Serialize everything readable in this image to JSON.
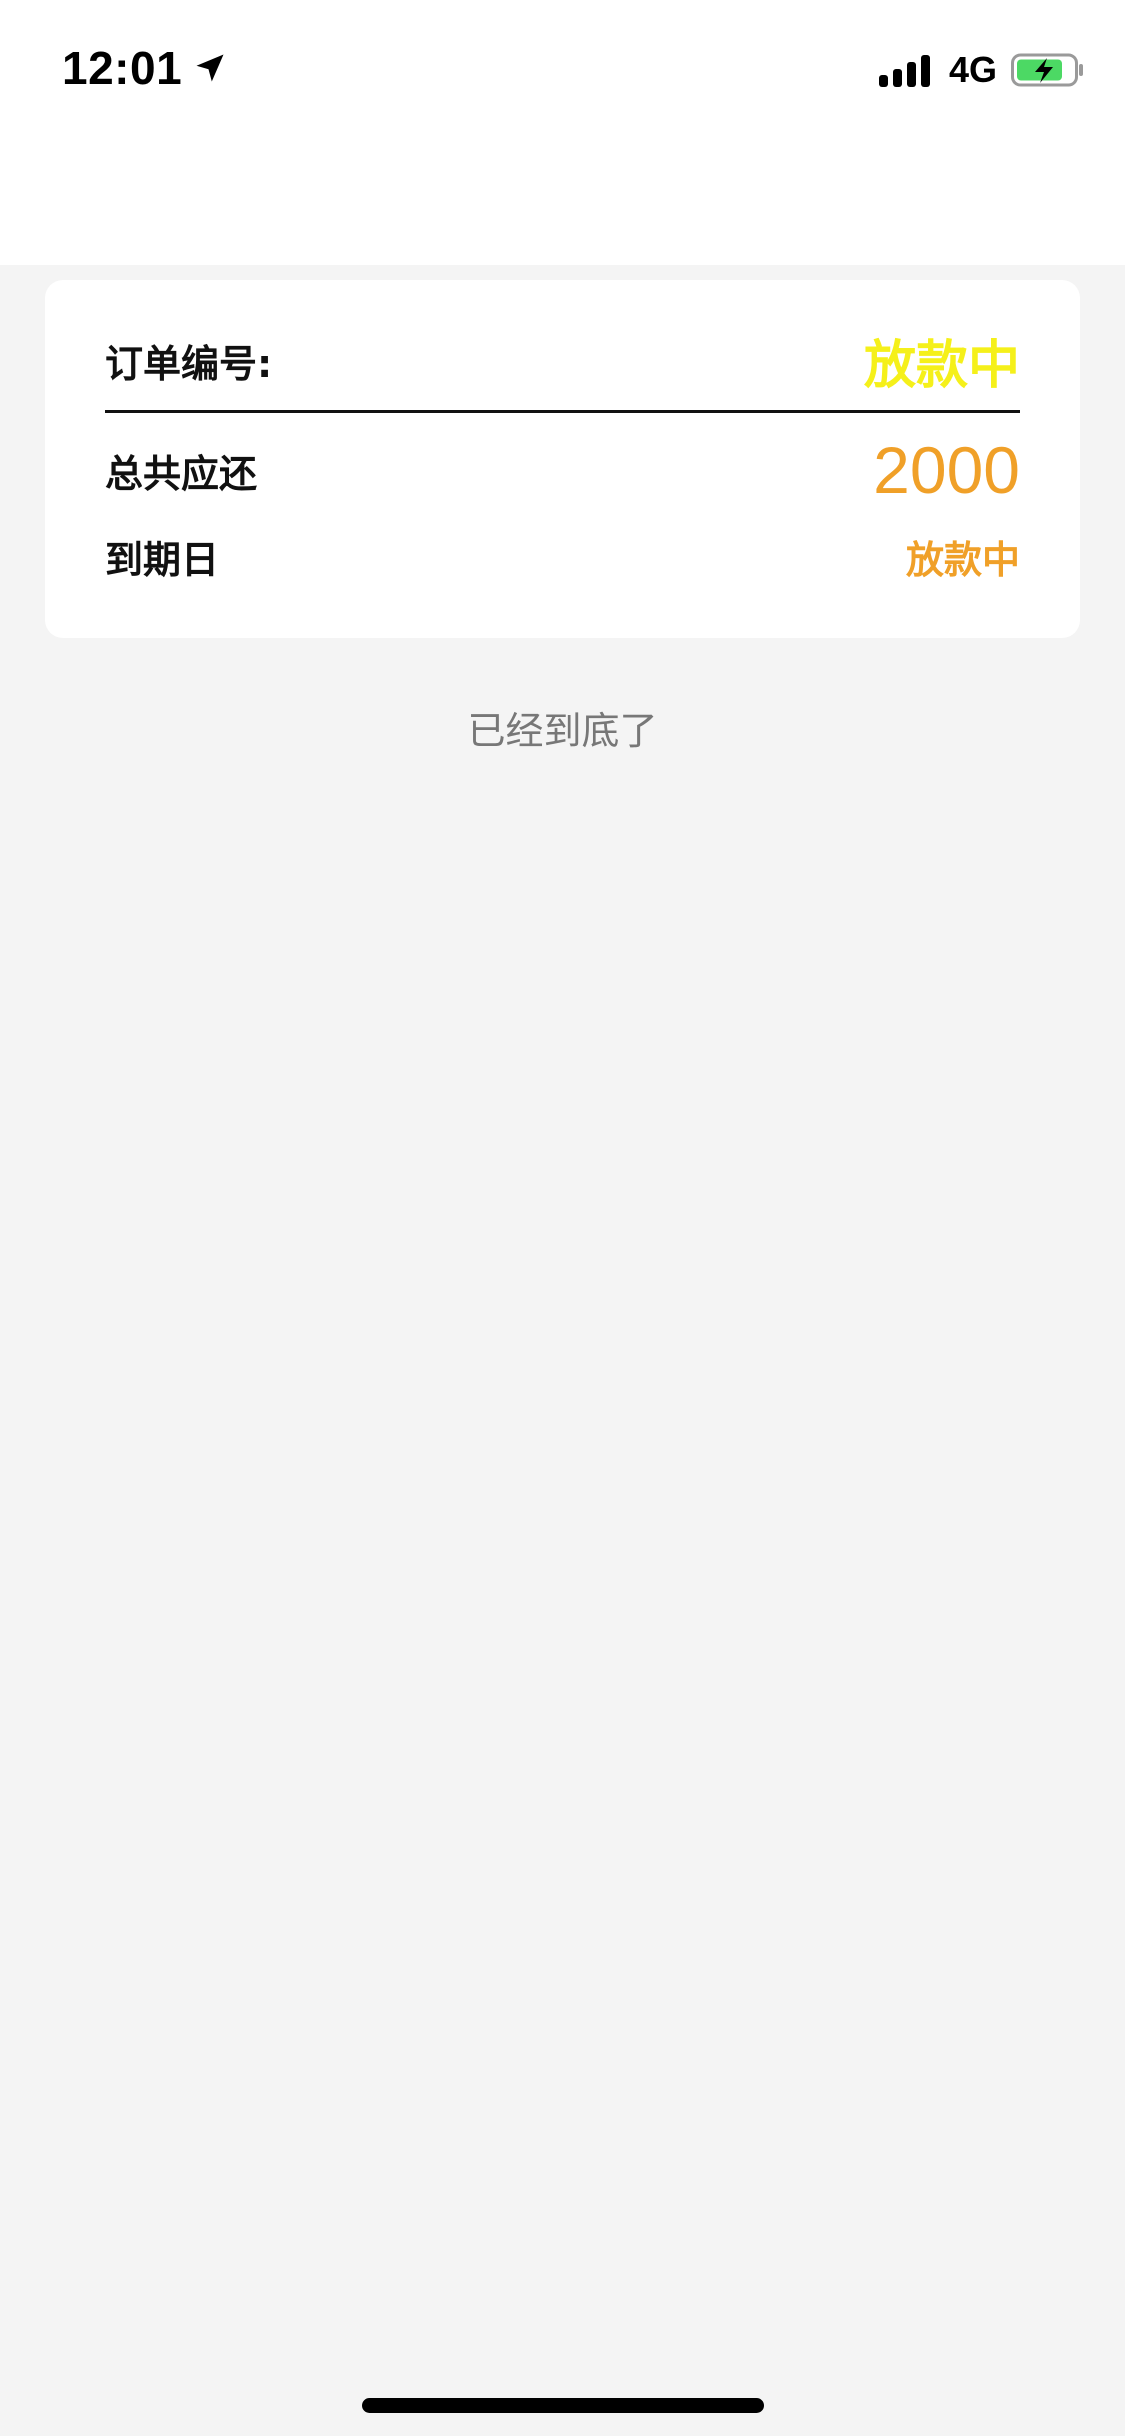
{
  "status_bar": {
    "time": "12:01",
    "network": "4G",
    "icons": [
      "location-arrow-icon",
      "signal-bars-icon",
      "battery-charging-icon"
    ],
    "battery_color": "#4cd964"
  },
  "order_card": {
    "order_label": "订单编号:",
    "order_status": "放款中",
    "total_label": "总共应还",
    "total_amount": "2000",
    "due_label": "到期日",
    "due_value": "放款中"
  },
  "list_footer": {
    "end_text": "已经到底了"
  },
  "colors": {
    "background": "#f4f4f4",
    "status_yellow": "#f5f01a",
    "accent_orange": "#f0a028"
  }
}
